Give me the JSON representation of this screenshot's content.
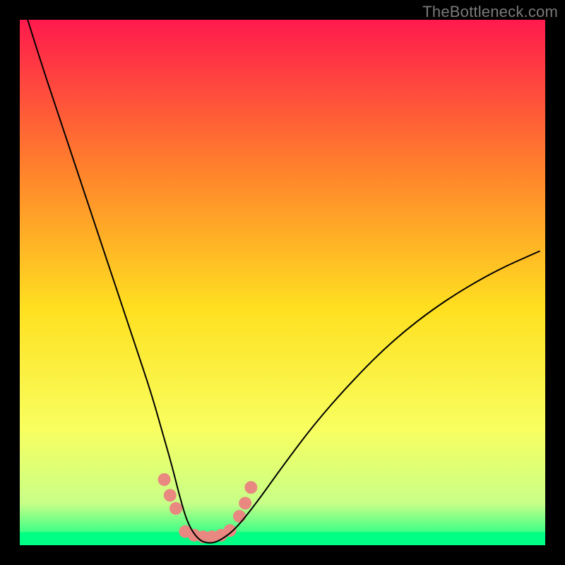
{
  "watermark": "TheBottleneck.com",
  "chart_data": {
    "type": "line",
    "title": "",
    "xlabel": "",
    "ylabel": "",
    "xlim": [
      0,
      100
    ],
    "ylim": [
      0,
      100
    ],
    "background_gradient": {
      "top": "#ff1a4d",
      "upper_mid": "#ff802c",
      "mid": "#ffe020",
      "lower_mid": "#f8ff60",
      "near_bottom": "#c8ff88",
      "bottom": "#00ff84"
    },
    "frame_color": "#000000",
    "series": [
      {
        "name": "bottleneck-curve",
        "color": "#000000",
        "stroke_width": 2,
        "x": [
          1.5,
          4,
          7,
          10,
          13,
          16,
          19,
          22,
          25,
          27,
          29,
          30.5,
          32,
          34,
          36,
          38,
          41,
          45,
          50,
          56,
          63,
          71,
          80,
          90,
          99
        ],
        "values": [
          100,
          92,
          83,
          74,
          65,
          56,
          47,
          38,
          29,
          22,
          15,
          9,
          4,
          1,
          0.3,
          0.8,
          3,
          8,
          15,
          23,
          31,
          39,
          46,
          52,
          56
        ]
      },
      {
        "name": "bottom-green-strip",
        "color": "#00ff84",
        "type": "area",
        "x": [
          0,
          100
        ],
        "values": [
          2.5,
          2.5
        ]
      },
      {
        "name": "marker-dots",
        "type": "scatter",
        "color": "#e98880",
        "radius": 9,
        "x": [
          27.5,
          28.6,
          29.7,
          31.5,
          33.2,
          34.9,
          36.6,
          38.3,
          40.0,
          41.8,
          42.9,
          44.0
        ],
        "values": [
          12.5,
          9.5,
          7.0,
          2.6,
          1.9,
          1.6,
          1.6,
          1.9,
          2.8,
          5.5,
          8.0,
          11.0
        ]
      }
    ]
  }
}
